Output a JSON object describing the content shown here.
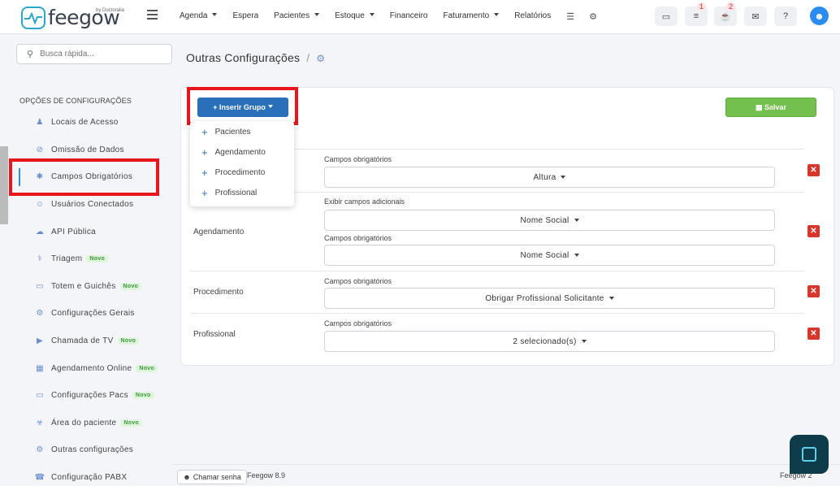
{
  "app": {
    "logo_text": "feegow",
    "logo_by": "by Doctoralia"
  },
  "nav": {
    "items": [
      {
        "label": "Agenda",
        "caret": true
      },
      {
        "label": "Espera",
        "caret": false
      },
      {
        "label": "Pacientes",
        "caret": true
      },
      {
        "label": "Estoque",
        "caret": true
      },
      {
        "label": "Financeiro",
        "caret": false
      },
      {
        "label": "Faturamento",
        "caret": true
      },
      {
        "label": "Relatórios",
        "caret": false
      }
    ],
    "badges": {
      "tasks": "1",
      "notifications": "2"
    }
  },
  "search": {
    "placeholder": "Busca rápida..."
  },
  "sidebar": {
    "section": "OPÇÕES DE CONFIGURAÇÕES",
    "items": [
      {
        "label": "Locais de Acesso",
        "icon": "user-pin-icon"
      },
      {
        "label": "Omissão de Dados",
        "icon": "eye-slash-icon"
      },
      {
        "label": "Campos Obrigatórios",
        "icon": "asterisk-icon"
      },
      {
        "label": "Usuários Conectados",
        "icon": "user-icon"
      },
      {
        "label": "API Pública",
        "icon": "cloud-upload-icon"
      },
      {
        "label": "Triagem",
        "icon": "stethoscope-icon",
        "badge": "Novo"
      },
      {
        "label": "Totem e Guichês",
        "icon": "laptop-icon",
        "badge": "Novo"
      },
      {
        "label": "Configurações Gerais",
        "icon": "gears-icon"
      },
      {
        "label": "Chamada de TV",
        "icon": "megaphone-icon",
        "badge": "Novo"
      },
      {
        "label": "Agendamento Online",
        "icon": "calendar-icon",
        "badge": "Novo"
      },
      {
        "label": "Configurações Pacs",
        "icon": "laptop-icon",
        "badge": "Novo"
      },
      {
        "label": "Área do paciente",
        "icon": "flask-icon",
        "badge": "Novo"
      },
      {
        "label": "Outras configurações",
        "icon": "gears-icon"
      },
      {
        "label": "Configuração PABX",
        "icon": "phone-icon"
      }
    ]
  },
  "main": {
    "title": "Outras Configurações",
    "insert_button": "Inserir Grupo",
    "save_button": "Salvar",
    "dropdown": [
      "Pacientes",
      "Agendamento",
      "Procedimento",
      "Profissional"
    ],
    "rows": [
      {
        "label": "",
        "fields": [
          {
            "label": "Campos obrigatórios",
            "value": "Altura"
          }
        ]
      },
      {
        "label": "Agendamento",
        "fields": [
          {
            "label": "Exibir campos adicionais",
            "value": "Nome Social"
          },
          {
            "label": "Campos obrigatórios",
            "value": "Nome Social"
          }
        ]
      },
      {
        "label": "Procedimento",
        "fields": [
          {
            "label": "Campos obrigatórios",
            "value": "Obrigar Profissional Solicitante"
          }
        ]
      },
      {
        "label": "Profissional",
        "fields": [
          {
            "label": "Campos obrigatórios",
            "value": "2 selecionado(s)"
          }
        ]
      }
    ]
  },
  "footer": {
    "chamar": "Chamar senha",
    "version": "Feegow 8.9",
    "right": "Feegow 2"
  }
}
